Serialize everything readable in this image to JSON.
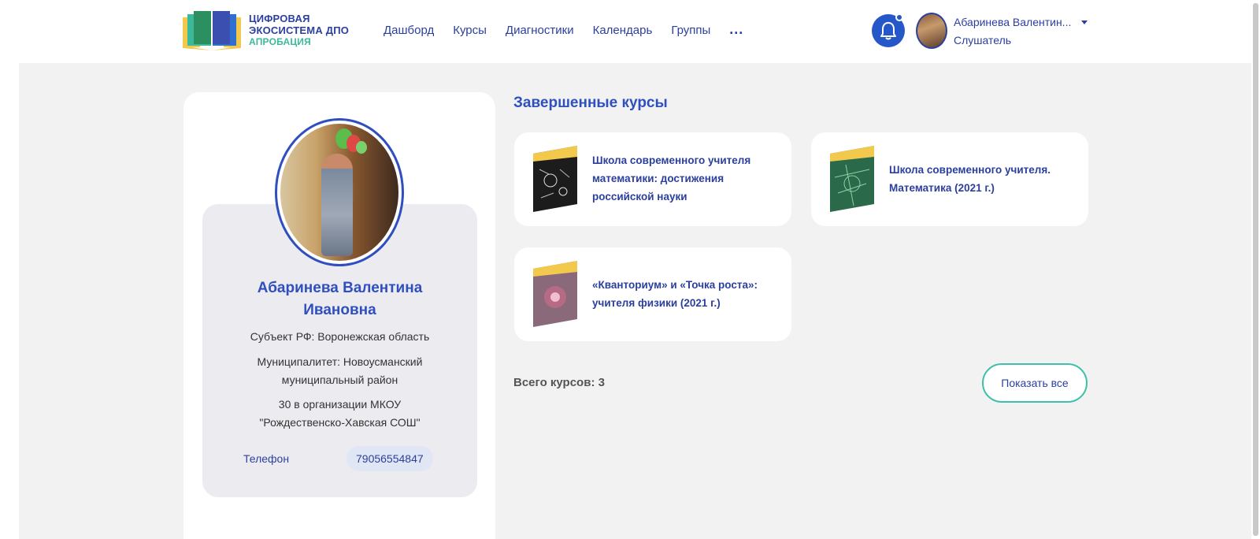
{
  "logo": {
    "line1": "ЦИФРОВАЯ",
    "line2": "ЭКОСИСТЕМА ДПО",
    "line3": "АПРОБАЦИЯ"
  },
  "nav": {
    "items": [
      "Дашборд",
      "Курсы",
      "Диагностики",
      "Календарь",
      "Группы"
    ],
    "more": "..."
  },
  "user": {
    "name": "Абаринева Валентин...",
    "role": "Слушатель"
  },
  "profile": {
    "name_line1": "Абаринева Валентина",
    "name_line2": "Ивановна",
    "region": "Субъект РФ: Воронежская область",
    "municipality_line1": "Муниципалитет: Новоусманский",
    "municipality_line2": "муниципальный район",
    "org_line1": "30 в организации МКОУ",
    "org_line2": "\"Рождественско-Хавская СОШ\"",
    "phone_label": "Телефон",
    "phone_value": "79056554847"
  },
  "courses": {
    "title": "Завершенные курсы",
    "items": [
      {
        "title": "Школа современного учителя математики: достижения российской науки"
      },
      {
        "title": "Школа современного учителя. Математика (2021 г.)"
      },
      {
        "title": "«Кванториум» и «Точка роста»: учителя физики (2021 г.)"
      }
    ],
    "total": "Всего курсов: 3",
    "show_all": "Показать все"
  },
  "colors": {
    "brand_blue": "#2b3f9e",
    "accent_blue": "#2f4fbf",
    "accent_green": "#3cc0a8",
    "thumb_yellow": "#f2c94c"
  }
}
